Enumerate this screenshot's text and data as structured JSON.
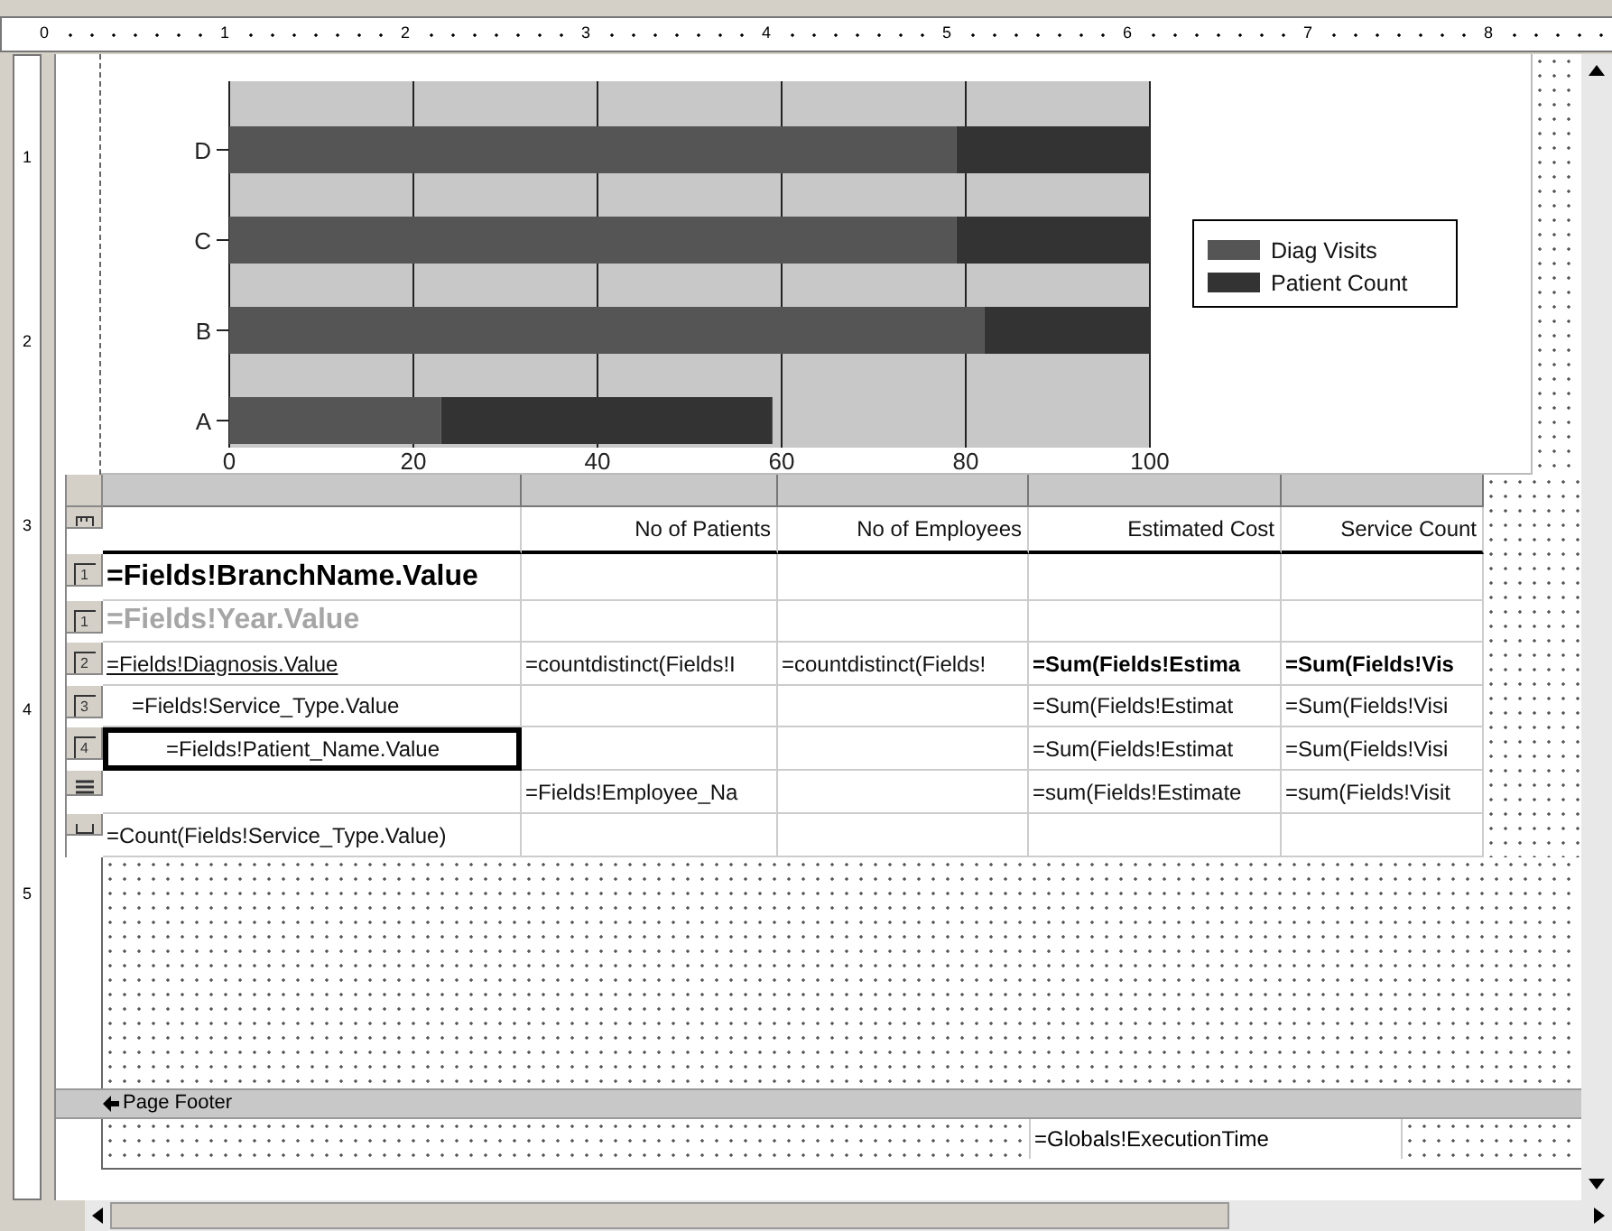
{
  "horizontal_ruler": {
    "marks": [
      "0",
      "1",
      "2",
      "3",
      "4",
      "5",
      "6",
      "7",
      "8"
    ]
  },
  "vertical_ruler": {
    "marks": [
      "1",
      "2",
      "3",
      "4",
      "5"
    ]
  },
  "chart": {
    "chart_data": {
      "type": "bar",
      "orientation": "horizontal",
      "stacked": true,
      "grid": true,
      "legend": true,
      "categories": [
        "D",
        "C",
        "B",
        "A"
      ],
      "series": [
        {
          "name": "Diag Visits",
          "color": "#555555",
          "values": [
            79,
            79,
            82,
            23
          ]
        },
        {
          "name": "Patient Count",
          "color": "#333333",
          "values": [
            21,
            21,
            18,
            36
          ]
        }
      ],
      "xlim": [
        0,
        100
      ],
      "xticks": [
        0,
        20,
        40,
        60,
        80,
        100
      ]
    }
  },
  "table": {
    "rows": [
      {
        "kind": "header",
        "cells": [
          {
            "selected": false
          },
          {
            "text": "No of Patients",
            "selected": false
          },
          {
            "text": "No of Employees",
            "selected": false
          },
          {
            "text": "Estimated Cost",
            "selected": false
          },
          {
            "text": "Service Count",
            "selected": false
          }
        ]
      },
      {
        "kind": "group",
        "handle_label": "1",
        "cells": [
          {
            "text": "=Fields!BranchName.Value",
            "selected": false
          },
          {
            "selected": false
          },
          {
            "selected": false
          },
          {
            "selected": false
          },
          {
            "selected": false
          }
        ]
      },
      {
        "kind": "group",
        "handle_label": "1",
        "cells": [
          {
            "text": "=Fields!Year.Value",
            "selected": false
          },
          {
            "selected": false
          },
          {
            "selected": false
          },
          {
            "selected": false
          },
          {
            "selected": false
          }
        ]
      },
      {
        "kind": "group",
        "handle_label": "2",
        "cells": [
          {
            "text": "=Fields!Diagnosis.Value",
            "selected": false
          },
          {
            "text": "=countdistinct(Fields!I",
            "selected": false
          },
          {
            "text": "=countdistinct(Fields!",
            "selected": false
          },
          {
            "text": "=Sum(Fields!Estima",
            "selected": false
          },
          {
            "text": "=Sum(Fields!Vis",
            "selected": false
          }
        ]
      },
      {
        "kind": "group",
        "handle_label": "3",
        "cells": [
          {
            "text": "=Fields!Service_Type.Value",
            "selected": false
          },
          {
            "selected": false
          },
          {
            "selected": false
          },
          {
            "text": "=Sum(Fields!Estimat",
            "selected": false
          },
          {
            "text": "=Sum(Fields!Visi",
            "selected": false
          }
        ]
      },
      {
        "kind": "group",
        "handle_label": "4",
        "cells": [
          {
            "text": "=Fields!Patient_Name.Value",
            "selected": true
          },
          {
            "selected": false
          },
          {
            "selected": false
          },
          {
            "text": "=Sum(Fields!Estimat",
            "selected": false
          },
          {
            "text": "=Sum(Fields!Visi",
            "selected": false
          }
        ]
      },
      {
        "kind": "detail",
        "cells": [
          {
            "selected": false
          },
          {
            "text": "=Fields!Employee_Na",
            "selected": false
          },
          {
            "selected": false
          },
          {
            "text": "=sum(Fields!Estimate",
            "selected": false
          },
          {
            "text": "=sum(Fields!Visit",
            "selected": false
          }
        ]
      },
      {
        "kind": "footer",
        "cells": [
          {
            "text": "=Count(Fields!Service_Type.Value)",
            "selected": false
          },
          {
            "selected": false
          },
          {
            "selected": false
          },
          {
            "selected": false
          },
          {
            "selected": false
          }
        ]
      }
    ]
  },
  "page_footer": {
    "title": "Page Footer",
    "textbox": "=Globals!ExecutionTime"
  }
}
